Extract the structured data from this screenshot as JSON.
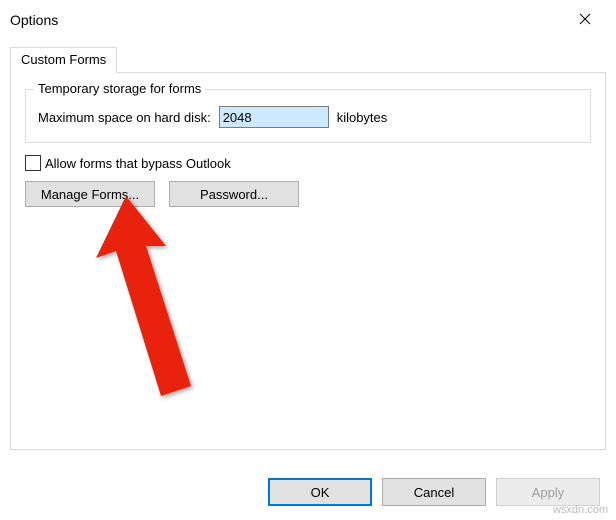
{
  "window": {
    "title": "Options"
  },
  "tabs": {
    "customForms": "Custom Forms"
  },
  "group": {
    "legend": "Temporary storage for forms",
    "maxSpaceLabel": "Maximum space on hard disk:",
    "maxSpaceValue": "2048",
    "unit": "kilobytes"
  },
  "checkbox": {
    "allowBypass": "Allow forms that bypass Outlook"
  },
  "buttons": {
    "manageForms": "Manage Forms...",
    "password": "Password..."
  },
  "footer": {
    "ok": "OK",
    "cancel": "Cancel",
    "apply": "Apply"
  },
  "watermark": "wsxdn.com"
}
